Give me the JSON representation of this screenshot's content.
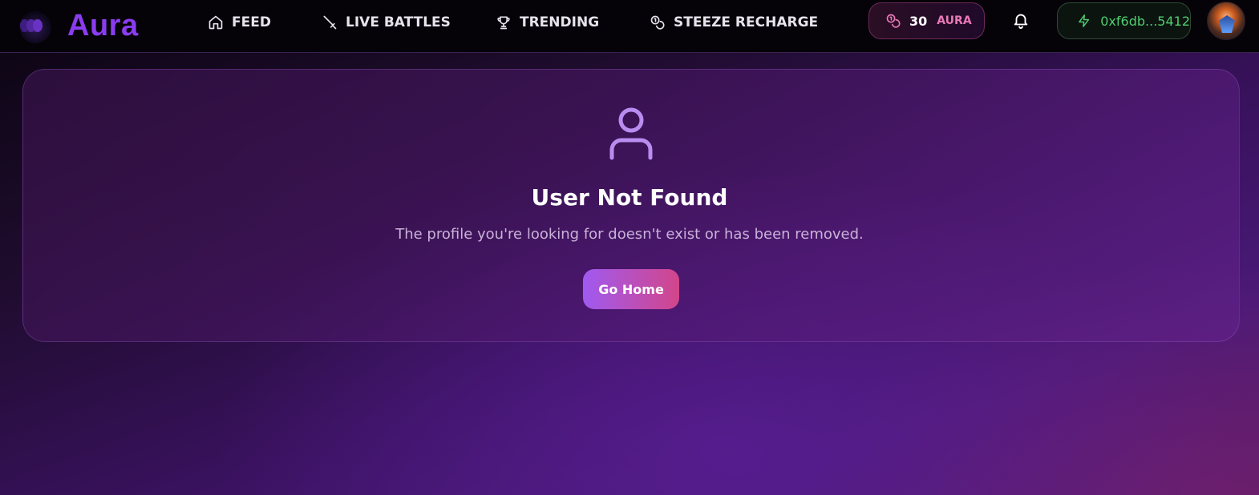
{
  "brand": {
    "name": "Aura",
    "color": "#8b3cf0"
  },
  "nav": {
    "feed": {
      "label": "FEED",
      "icon": "home-icon"
    },
    "battles": {
      "label": "LIVE BATTLES",
      "icon": "sword-icon"
    },
    "trending": {
      "label": "TRENDING",
      "icon": "trophy-icon"
    },
    "steeze": {
      "label": "STEEZE RECHARGE",
      "icon": "coins-icon"
    }
  },
  "balance": {
    "count": "30",
    "unit": "AURA",
    "icon": "coins-icon"
  },
  "notifications": {
    "icon": "bell-icon"
  },
  "wallet": {
    "address": "0xf6db...5412",
    "icon": "lightning-icon"
  },
  "error": {
    "title": "User Not Found",
    "message": "The profile you're looking for doesn't exist or has been removed.",
    "button": "Go Home",
    "icon": "user-icon"
  },
  "colors": {
    "accent": "#8b3cf0",
    "wallet_green": "#4fcf6f",
    "aura_pink": "#e879b8",
    "icon_purple": "#b98cf0"
  }
}
